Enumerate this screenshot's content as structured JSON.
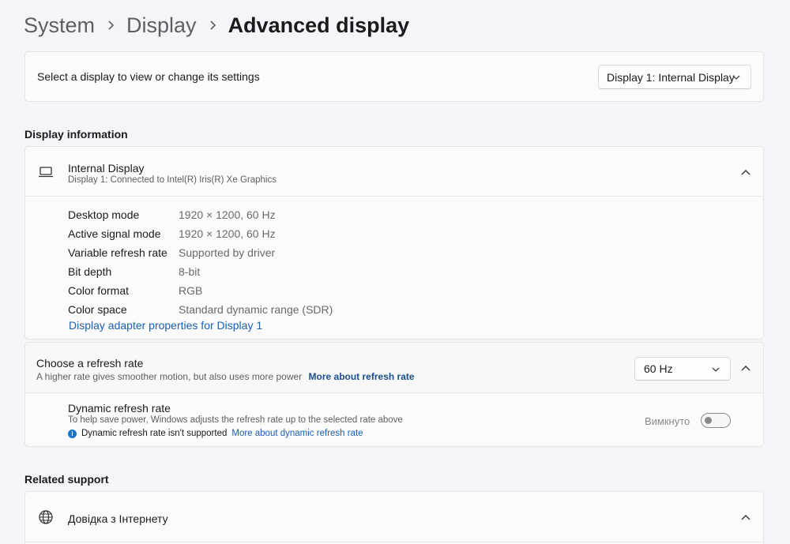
{
  "breadcrumb": {
    "items": [
      "System",
      "Display"
    ],
    "current": "Advanced display"
  },
  "display_select": {
    "label": "Select a display to view or change its settings",
    "value": "Display 1: Internal Display"
  },
  "display_information": {
    "section_title": "Display information",
    "title": "Internal Display",
    "subtitle": "Display 1: Connected to Intel(R) Iris(R) Xe Graphics",
    "rows": [
      {
        "key": "Desktop mode",
        "value": "1920 × 1200, 60 Hz"
      },
      {
        "key": "Active signal mode",
        "value": "1920 × 1200, 60 Hz"
      },
      {
        "key": "Variable refresh rate",
        "value": "Supported by driver"
      },
      {
        "key": "Bit depth",
        "value": "8-bit"
      },
      {
        "key": "Color format",
        "value": "RGB"
      },
      {
        "key": "Color space",
        "value": "Standard dynamic range (SDR)"
      }
    ],
    "adapter_link": "Display adapter properties for Display 1"
  },
  "refresh_rate": {
    "title": "Choose a refresh rate",
    "subtitle": "A higher rate gives smoother motion, but also uses more power",
    "link": "More about refresh rate",
    "value": "60 Hz",
    "dynamic": {
      "title": "Dynamic refresh rate",
      "subtitle": "To help save power, Windows adjusts the refresh rate up to the selected rate above",
      "note": "Dynamic refresh rate isn't supported",
      "note_link": "More about dynamic refresh rate",
      "toggle_label": "Вимкнуто",
      "toggle_on": false
    }
  },
  "related_support": {
    "section_title": "Related support",
    "help_title": "Довідка з Інтернету"
  },
  "colors": {
    "background": "#f3f5f9",
    "card": "#fbfbfb",
    "link": "#1a5fb4",
    "info_accent": "#1a73c6"
  },
  "icons": [
    "chevron-right-icon",
    "chevron-down-icon",
    "chevron-up-icon",
    "laptop-icon",
    "info-icon",
    "globe-icon"
  ]
}
